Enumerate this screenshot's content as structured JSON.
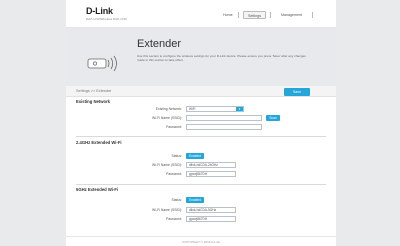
{
  "header": {
    "brand": "D-Link",
    "model": "DAP-1720/Wireless DAP-1720",
    "nav": [
      "Home",
      "Settings",
      "Management"
    ],
    "active_nav": "Settings"
  },
  "hero": {
    "title": "Extender",
    "description": "Use this section to configure the wireless settings for your D-Link device. Please ensure you press 'Save' after any changes made in this section to take effect.",
    "icon": "extender-wifi-icon"
  },
  "breadcrumb": "Settings >> Extender",
  "save_label": "Save",
  "existing_network": {
    "title": "Existing Network",
    "labels": [
      "Existing Network:",
      "Wi-Fi Name (SSID):",
      "Password:"
    ],
    "existing_network_value": "WiFi",
    "scan_label": "Scan"
  },
  "wifi24": {
    "title": "2.4GHz Extended Wi-Fi",
    "labels": [
      "Status:",
      "Wi-Fi Name (SSID):",
      "Password:"
    ],
    "status": "Enabled",
    "ssid": "dlink-hdCDA-24GHz",
    "password": "gpxwj867DH"
  },
  "wifi5": {
    "title": "5GHz Extended Wi-Fi",
    "labels": [
      "Status:",
      "Wi-Fi Name (SSID):",
      "Password:"
    ],
    "status": "Enabled",
    "ssid": "dlink-hdCDA-5GHz",
    "password": "gpxwj867DH"
  },
  "footer": "COPYRIGHT © 2016 D-Link",
  "colors": {
    "accent": "#25a6d8",
    "hero_bg": "#e7e9ec",
    "page_bg": "#e9eaec"
  }
}
